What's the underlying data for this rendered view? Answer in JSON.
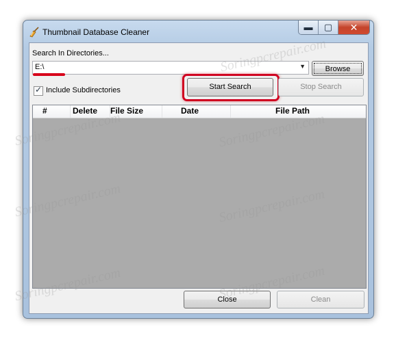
{
  "window": {
    "title": "Thumbnail Database Cleaner",
    "minimize_glyph": "▬",
    "maximize_glyph": "▢",
    "close_glyph": "✕"
  },
  "search": {
    "label": "Search In Directories...",
    "directory_value": "E:\\",
    "browse_label": "Browse"
  },
  "options": {
    "include_subdirectories_label": "Include Subdirectories",
    "include_subdirectories_checked": true,
    "check_glyph": "✓"
  },
  "actions": {
    "start_search_label": "Start Search",
    "stop_search_label": "Stop Search",
    "close_label": "Close",
    "clean_label": "Clean"
  },
  "results_table": {
    "columns": [
      "#",
      "Delete",
      "File Size",
      "Date",
      "File Path"
    ],
    "rows": []
  },
  "watermark_text": "Soringpcrepair.com",
  "colors": {
    "highlight_red": "#d00020",
    "list_background": "#ababab",
    "title_bar": "#b9cfe6"
  }
}
